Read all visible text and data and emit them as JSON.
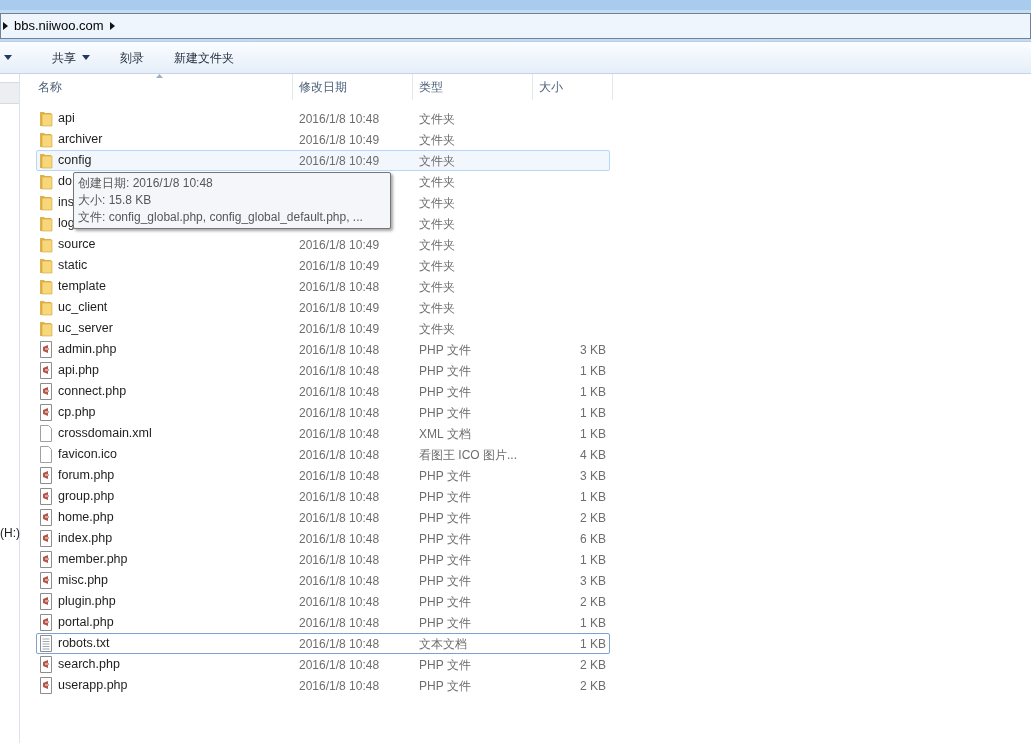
{
  "address_bar": {
    "path": [
      "bbs.niiwoo.com"
    ]
  },
  "toolbar": {
    "items": [
      {
        "label": "共享",
        "dropdown": true
      },
      {
        "label": "刻录",
        "dropdown": false
      },
      {
        "label": "新建文件夹",
        "dropdown": false
      }
    ]
  },
  "sidebar": {
    "drive_label": "(H:)"
  },
  "columns": [
    {
      "label": "名称",
      "sorted": true
    },
    {
      "label": "修改日期",
      "sorted": false
    },
    {
      "label": "类型",
      "sorted": false
    },
    {
      "label": "大小",
      "sorted": false
    }
  ],
  "files": [
    {
      "kind": "folder",
      "name": "api",
      "date": "2016/1/8 10:48",
      "type": "文件夹",
      "hovered": false,
      "focused": false
    },
    {
      "kind": "folder",
      "name": "archiver",
      "date": "2016/1/8 10:49",
      "type": "文件夹",
      "hovered": false,
      "focused": false
    },
    {
      "kind": "folder",
      "name": "config",
      "date": "2016/1/8 10:49",
      "type": "文件夹",
      "hovered": true,
      "focused": false
    },
    {
      "kind": "folder",
      "name": "do",
      "type": "文件夹",
      "hovered": false,
      "focused": false
    },
    {
      "kind": "folder",
      "name": "ins",
      "type": "文件夹",
      "hovered": false,
      "focused": false
    },
    {
      "kind": "folder",
      "name": "log",
      "type": "文件夹",
      "hovered": false,
      "focused": false
    },
    {
      "kind": "folder",
      "name": "source",
      "date": "2016/1/8 10:49",
      "type": "文件夹",
      "hovered": false,
      "focused": false
    },
    {
      "kind": "folder",
      "name": "static",
      "date": "2016/1/8 10:49",
      "type": "文件夹",
      "hovered": false,
      "focused": false
    },
    {
      "kind": "folder",
      "name": "template",
      "date": "2016/1/8 10:48",
      "type": "文件夹",
      "hovered": false,
      "focused": false
    },
    {
      "kind": "folder",
      "name": "uc_client",
      "date": "2016/1/8 10:49",
      "type": "文件夹",
      "hovered": false,
      "focused": false
    },
    {
      "kind": "folder",
      "name": "uc_server",
      "date": "2016/1/8 10:49",
      "type": "文件夹",
      "hovered": false,
      "focused": false
    },
    {
      "kind": "php",
      "name": "admin.php",
      "date": "2016/1/8 10:48",
      "type": "PHP 文件",
      "size": "3 KB",
      "hovered": false,
      "focused": false
    },
    {
      "kind": "php",
      "name": "api.php",
      "date": "2016/1/8 10:48",
      "type": "PHP 文件",
      "size": "1 KB",
      "hovered": false,
      "focused": false
    },
    {
      "kind": "php",
      "name": "connect.php",
      "date": "2016/1/8 10:48",
      "type": "PHP 文件",
      "size": "1 KB",
      "hovered": false,
      "focused": false
    },
    {
      "kind": "php",
      "name": "cp.php",
      "date": "2016/1/8 10:48",
      "type": "PHP 文件",
      "size": "1 KB",
      "hovered": false,
      "focused": false
    },
    {
      "kind": "blank",
      "name": "crossdomain.xml",
      "date": "2016/1/8 10:48",
      "type": "XML 文档",
      "size": "1 KB",
      "hovered": false,
      "focused": false
    },
    {
      "kind": "blank",
      "name": "favicon.ico",
      "date": "2016/1/8 10:48",
      "type": "看图王 ICO 图片...",
      "size": "4 KB",
      "hovered": false,
      "focused": false
    },
    {
      "kind": "php",
      "name": "forum.php",
      "date": "2016/1/8 10:48",
      "type": "PHP 文件",
      "size": "3 KB",
      "hovered": false,
      "focused": false
    },
    {
      "kind": "php",
      "name": "group.php",
      "date": "2016/1/8 10:48",
      "type": "PHP 文件",
      "size": "1 KB",
      "hovered": false,
      "focused": false
    },
    {
      "kind": "php",
      "name": "home.php",
      "date": "2016/1/8 10:48",
      "type": "PHP 文件",
      "size": "2 KB",
      "hovered": false,
      "focused": false
    },
    {
      "kind": "php",
      "name": "index.php",
      "date": "2016/1/8 10:48",
      "type": "PHP 文件",
      "size": "6 KB",
      "hovered": false,
      "focused": false
    },
    {
      "kind": "php",
      "name": "member.php",
      "date": "2016/1/8 10:48",
      "type": "PHP 文件",
      "size": "1 KB",
      "hovered": false,
      "focused": false
    },
    {
      "kind": "php",
      "name": "misc.php",
      "date": "2016/1/8 10:48",
      "type": "PHP 文件",
      "size": "3 KB",
      "hovered": false,
      "focused": false
    },
    {
      "kind": "php",
      "name": "plugin.php",
      "date": "2016/1/8 10:48",
      "type": "PHP 文件",
      "size": "2 KB",
      "hovered": false,
      "focused": false
    },
    {
      "kind": "php",
      "name": "portal.php",
      "date": "2016/1/8 10:48",
      "type": "PHP 文件",
      "size": "1 KB",
      "hovered": false,
      "focused": false
    },
    {
      "kind": "text",
      "name": "robots.txt",
      "date": "2016/1/8 10:48",
      "type": "文本文档",
      "size": "1 KB",
      "hovered": false,
      "focused": true
    },
    {
      "kind": "php",
      "name": "search.php",
      "date": "2016/1/8 10:48",
      "type": "PHP 文件",
      "size": "2 KB",
      "hovered": false,
      "focused": false
    },
    {
      "kind": "php",
      "name": "userapp.php",
      "date": "2016/1/8 10:48",
      "type": "PHP 文件",
      "size": "2 KB",
      "hovered": false,
      "focused": false
    }
  ],
  "tooltip": {
    "lines": [
      "创建日期: 2016/1/8 10:48",
      "大小: 15.8 KB",
      "文件: config_global.php, config_global_default.php, ..."
    ]
  }
}
